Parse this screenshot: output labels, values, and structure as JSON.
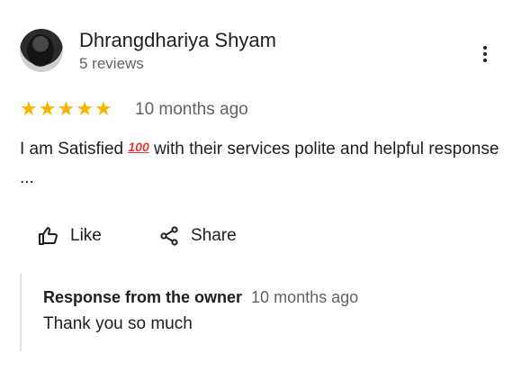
{
  "review": {
    "author": "Dhrangdhariya Shyam",
    "reviews_count": "5 reviews",
    "rating": 5,
    "stars": [
      "★",
      "★",
      "★",
      "★",
      "★"
    ],
    "date": "10 months ago",
    "text_before": "I am Satisfied",
    "emoji": "100",
    "text_after": " with their services polite and helpful response ...",
    "actions": {
      "like": "Like",
      "share": "Share"
    }
  },
  "owner_response": {
    "title": "Response from the owner",
    "date": "10 months ago",
    "text": "Thank you so much"
  },
  "colors": {
    "star": "#f4b400",
    "secondary_text": "#5f6368"
  }
}
